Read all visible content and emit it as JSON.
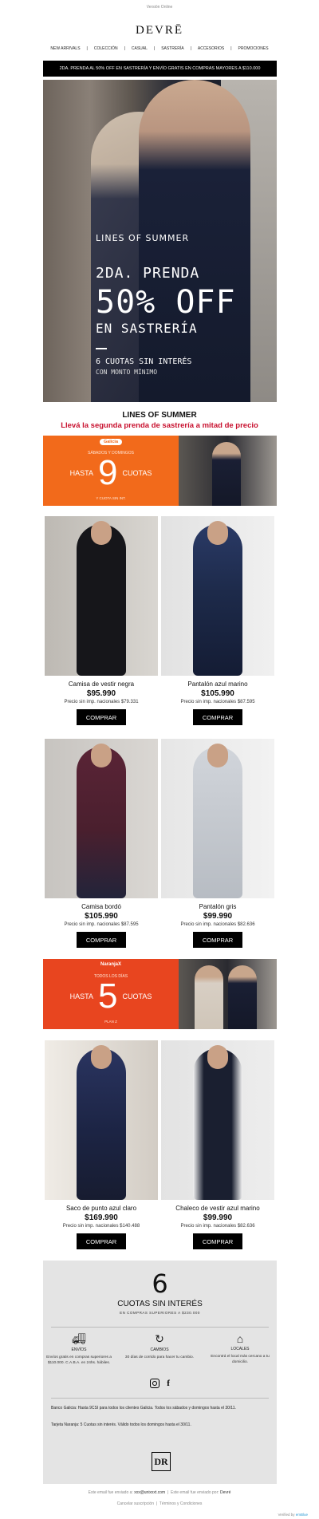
{
  "header": {
    "version_link": "Versión Online",
    "logo": "DEVRĒ",
    "nav": [
      "NEW ARRIVALS",
      "|",
      "COLECCIÓN",
      "|",
      "CASUAL",
      "|",
      "SASTRERÍA",
      "|",
      "ACCESORIOS",
      "|",
      "PROMOCIONES"
    ],
    "promo_bar": "2DA. PRENDA AL 50% OFF EN SASTRERÍA Y ENVÍO GRATIS EN COMPRAS MAYORES A $110.000"
  },
  "hero": {
    "line1": "LINES OF SUMMER",
    "line2": "2DA. PRENDA",
    "line3": "50% OFF",
    "line4": "EN SASTRERÍA",
    "line5": "6 CUOTAS SIN INTERÉS",
    "line6": "CON MONTO MÍNIMO"
  },
  "section": {
    "title": "LINES OF SUMMER",
    "subtitle": "Llevá la segunda prenda de sastrería a mitad de precio"
  },
  "banner_galicia": {
    "brand": "Galicia",
    "days": "SÁBADOS Y DOMINGOS",
    "hasta": "HASTA",
    "number": "9",
    "cuotas": "CUOTAS",
    "footnote": "Y CUOTA SIN INT."
  },
  "banner_naranja": {
    "brand": "NaranjaX",
    "days": "TODOS LOS DÍAS",
    "hasta": "HASTA",
    "number": "5",
    "cuotas": "CUOTAS",
    "footnote": "PLAN Z"
  },
  "products": [
    {
      "name": "Camisa de vestir negra",
      "price": "$95.990",
      "imp": "Precio sin imp. nacionales $79.331",
      "cta": "COMPRAR",
      "bg": "#d4d2cf",
      "garment": "#16161a"
    },
    {
      "name": "Pantalón azul marino",
      "price": "$105.990",
      "imp": "Precio sin imp. nacionales $87.595",
      "cta": "COMPRAR",
      "bg": "#e6e6e6",
      "garment": "#1d2a4a"
    },
    {
      "name": "Camisa bordó",
      "price": "$105.990",
      "imp": "Precio sin imp. nacionales $87.595",
      "cta": "COMPRAR",
      "bg": "#cfcdca",
      "garment": "#4a1f2e"
    },
    {
      "name": "Pantalón gris",
      "price": "$99.990",
      "imp": "Precio sin imp. nacionales $82.636",
      "cta": "COMPRAR",
      "bg": "#e8e8e8",
      "garment": "#c7cbd1"
    },
    {
      "name": "Saco de punto azul claro",
      "price": "$169.990",
      "imp": "Precio sin imp. nacionales $140.488",
      "cta": "COMPRAR",
      "bg": "#dcd8d2",
      "garment": "#1c2444"
    },
    {
      "name": "Chaleco de vestir azul marino",
      "price": "$99.990",
      "imp": "Precio sin imp. nacionales $82.636",
      "cta": "COMPRAR",
      "bg": "#e5e5e5",
      "garment": "#1a1f30"
    }
  ],
  "footer_box": {
    "number": "6",
    "title": "CUOTAS SIN INTERÉS",
    "subtitle": "EN COMPRAS SUPERIORES A $230.000",
    "services": [
      {
        "icon": "truck-icon",
        "title": "ENVÍOS",
        "desc": "Envíos gratis en compras superiores a $110.000. C.A.B.A. en 24hs. hábiles."
      },
      {
        "icon": "return-icon",
        "title": "CAMBIOS",
        "desc": "30 días de corrido para hacer tu cambio."
      },
      {
        "icon": "store-icon",
        "title": "LOCALES",
        "desc": "Encontrá el local más cercano a tu domicilio."
      }
    ],
    "legal1": "Banco Galicia: Hasta 9CSI para todos los clientes Galicia. Todos los sábados y domingos hasta el 30/11.",
    "legal2": "Tarjeta Naranja: 5 Cuotas sin interés. Válido todos los domingos hasta el 30/11.",
    "monogram": "DR"
  },
  "footer": {
    "sent_to_prefix": "Este email fue enviado a:",
    "sent_to_email": "xxx@unixxxt.com",
    "sent_by_prefix": "Este email fue enviado por:",
    "sent_by": "Devré",
    "unsubscribe": "Cancelar suscripción",
    "terms": "Términos y Condiciones",
    "verified_prefix": "Verified by",
    "verified_brand": "emBlue"
  },
  "colors": {
    "accent_red": "#c8102e",
    "galicia_orange": "#f26a1b",
    "naranja_red": "#e8451f"
  }
}
